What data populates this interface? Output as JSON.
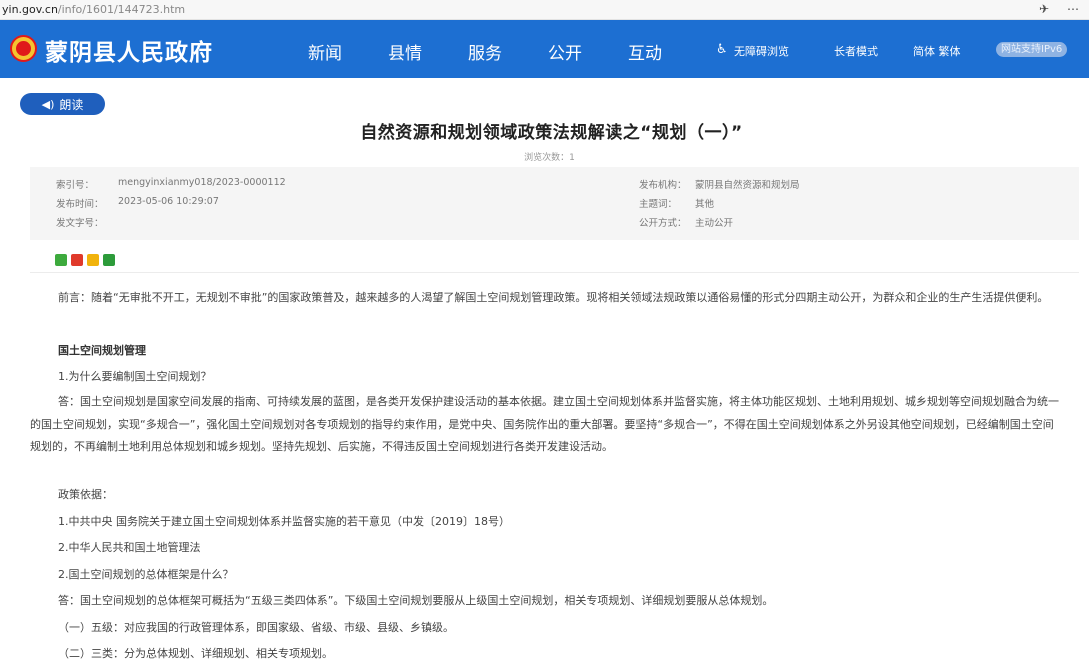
{
  "browser": {
    "url_host": "yin.gov.cn",
    "url_path": "/info/1601/144723.htm",
    "icons": [
      "pin-icon",
      "more-icon"
    ]
  },
  "header": {
    "site_title": "蒙阴县人民政府",
    "nav": [
      "新闻",
      "县情",
      "服务",
      "公开",
      "互动"
    ],
    "tools": {
      "accessible": "无障碍浏览",
      "elder": "长者模式",
      "lang": "简体 繁体",
      "ipv6": "网站支持IPv6"
    },
    "colors": {
      "header_bg": "#1d6fd2",
      "read_btn": "#1f5fbd"
    }
  },
  "read_button": "朗读",
  "article": {
    "title": "自然资源和规划领域政策法规解读之“规划（一）”",
    "views": "浏览次数：1"
  },
  "meta": {
    "index_no_label": "索引号：",
    "index_no": "mengyinxianmy018/2023-0000112",
    "publish_time_label": "发布时间：",
    "publish_time": "2023-05-06 10:29:07",
    "doc_no_label": "发文字号：",
    "doc_no": "",
    "org_label": "发布机构：",
    "org": "蒙阴县自然资源和规划局",
    "topic_label": "主题词：",
    "topic": "其他",
    "open_label": "公开方式：",
    "open": "主动公开"
  },
  "share_icons": [
    "wechat-icon",
    "weibo-icon",
    "qzone-icon",
    "douban-icon"
  ],
  "body": {
    "intro": "前言：随着“无审批不开工，无规划不审批”的国家政策普及，越来越多的人渴望了解国土空间规划管理政策。现将相关领域法规政策以通俗易懂的形式分四期主动公开，为群众和企业的生产生活提供便利。",
    "section_heading": "国土空间规划管理",
    "q1": "1.为什么要编制国土空间规划？",
    "a1": "答：国土空间规划是国家空间发展的指南、可持续发展的蓝图，是各类开发保护建设活动的基本依据。建立国土空间规划体系并监督实施，将主体功能区规划、土地利用规划、城乡规划等空间规划融合为统一的国土空间规划，实现“多规合一”，强化国土空间规划对各专项规划的指导约束作用，是党中央、国务院作出的重大部署。要坚持“多规合一”，不得在国土空间规划体系之外另设其他空间规划，已经编制国土空间规划的，不再编制土地利用总体规划和城乡规划。坚持先规划、后实施，不得违反国土空间规划进行各类开发建设活动。",
    "basis_label": "政策依据：",
    "basis1": "1.中共中央 国务院关于建立国土空间规划体系并监督实施的若干意见（中发〔2019〕18号）",
    "basis2": "2.中华人民共和国土地管理法",
    "q2": "2.国土空间规划的总体框架是什么？",
    "a2": "答：国土空间规划的总体框架可概括为“五级三类四体系”。下级国土空间规划要服从上级国土空间规划，相关专项规划、详细规划要服从总体规划。",
    "level5": "（一）五级：对应我国的行政管理体系，即国家级、省级、市级、县级、乡镇级。",
    "type3": "（二）三类：分为总体规划、详细规划、相关专项规划。"
  }
}
